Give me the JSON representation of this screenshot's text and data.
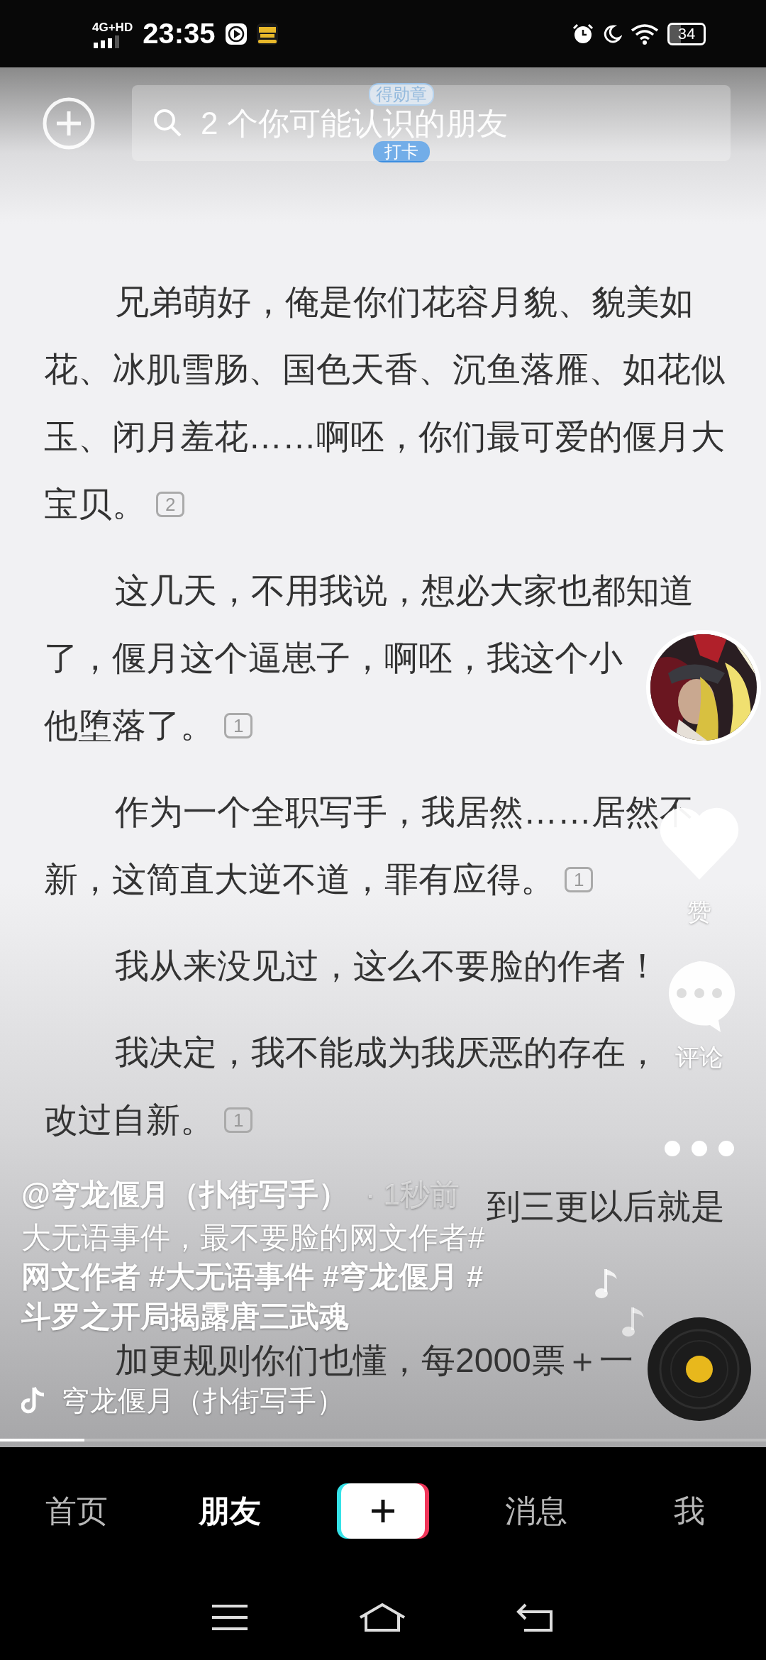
{
  "status_bar": {
    "network": "4G+HD",
    "time": "23:35",
    "battery": "34"
  },
  "search": {
    "placeholder": "2 个你可能认识的朋友"
  },
  "article": {
    "badge_top": "得勋章",
    "badge_bottom": "打卡",
    "paragraphs": [
      {
        "lines": [
          "兄弟萌好，俺是你们花容月貌、貌美如",
          "花、冰肌雪肠、国色天香、沉鱼落雁、如花似",
          "玉、闭月羞花……啊呸，你们最可爱的偃月大",
          "宝贝。"
        ],
        "comments": "2"
      },
      {
        "lines": [
          "这几天，不用我说，想必大家也都知道",
          "了，偃月这个逼崽子，啊呸，我这个小",
          "他堕落了。"
        ],
        "comments": "1"
      },
      {
        "lines": [
          "作为一个全职写手，我居然……居然不",
          "新，这简直大逆不道，罪有应得。"
        ],
        "comments": "1"
      },
      {
        "lines": [
          "我从来没见过，这么不要脸的作者！"
        ]
      },
      {
        "lines": [
          "我决定，我不能成为我厌恶的存在，",
          "改过自新。"
        ],
        "comments": "1"
      },
      {
        "lines": [
          {
            "kind": "tail",
            "text": "到三更以后就是"
          },
          {
            "kind": "covered"
          }
        ]
      },
      {
        "lines": [
          "加更规则你们也懂，每2000票＋一"
        ]
      }
    ]
  },
  "side_actions": {
    "like_label": "赞",
    "comment_label": "评论"
  },
  "post": {
    "author": "@穹龙偃月（扑街写手）",
    "time": "· 1秒前",
    "description": [
      {
        "kind": "text",
        "text": "大无语事件，最不要脸的网文作者#"
      },
      {
        "kind": "tags",
        "text": "网文作者 #大无语事件 #穹龙偃月 #"
      },
      {
        "kind": "tags",
        "text": "斗罗之开局揭露唐三武魂"
      }
    ],
    "music": "穹龙偃月（扑街写手）"
  },
  "progress": {
    "level": 0.11
  },
  "tabs": [
    {
      "kind": "tab",
      "label": "首页",
      "selected": false
    },
    {
      "kind": "tab",
      "label": "朋友",
      "selected": true
    },
    {
      "kind": "create"
    },
    {
      "kind": "tab",
      "label": "消息",
      "selected": false
    },
    {
      "kind": "tab",
      "label": "我",
      "selected": false
    }
  ]
}
